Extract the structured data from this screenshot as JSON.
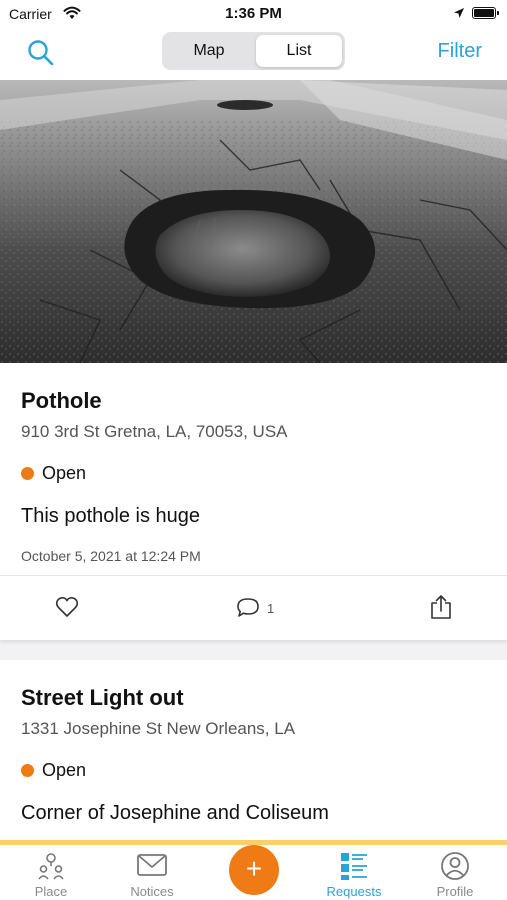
{
  "status_bar": {
    "carrier": "Carrier",
    "time": "1:36 PM"
  },
  "nav": {
    "segments": {
      "map": "Map",
      "list": "List"
    },
    "filter": "Filter",
    "active_segment": "List"
  },
  "requests": [
    {
      "title": "Pothole",
      "address": "910 3rd St Gretna, LA, 70053, USA",
      "status": "Open",
      "status_color": "#ee7a13",
      "description": "This pothole is huge",
      "date": "October 5, 2021 at 12:24 PM",
      "comment_count": "1"
    },
    {
      "title": "Street Light out",
      "address": "1331 Josephine St New Orleans, LA",
      "status": "Open",
      "status_color": "#ee7a13",
      "description": "Corner of Josephine and Coliseum"
    }
  ],
  "tabbar": {
    "items": [
      {
        "label": "Place",
        "icon": "place-icon"
      },
      {
        "label": "Notices",
        "icon": "mail-icon"
      },
      {
        "label": "Requests",
        "icon": "list-icon",
        "active": true
      },
      {
        "label": "Profile",
        "icon": "profile-icon"
      }
    ],
    "fab": "+"
  },
  "colors": {
    "accent": "#2aa3d6",
    "fab": "#ef7b17",
    "status_open": "#ee7a13",
    "tab_top_border": "#fbcf69"
  }
}
